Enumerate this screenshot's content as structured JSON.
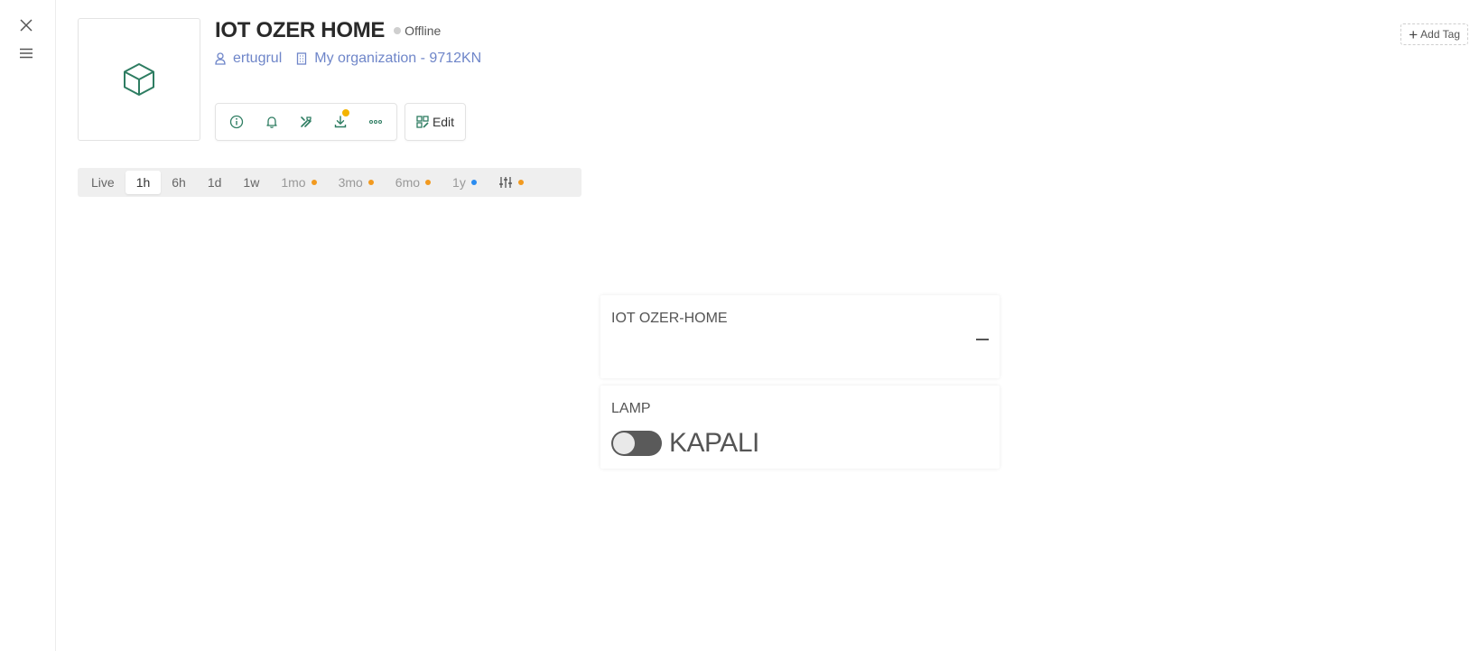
{
  "device": {
    "title": "IOT OZER HOME",
    "status": "Offline",
    "owner": "ertugrul",
    "organization": "My organization - 9712KN"
  },
  "toolbar": {
    "edit_label": "Edit",
    "icons": [
      "info-icon",
      "bell-icon",
      "tools-icon",
      "download-icon",
      "more-icon"
    ]
  },
  "add_tag_label": "Add Tag",
  "time_ranges": [
    {
      "label": "Live",
      "active": false,
      "dim": false,
      "dot": null
    },
    {
      "label": "1h",
      "active": true,
      "dim": false,
      "dot": null
    },
    {
      "label": "6h",
      "active": false,
      "dim": false,
      "dot": null
    },
    {
      "label": "1d",
      "active": false,
      "dim": false,
      "dot": null
    },
    {
      "label": "1w",
      "active": false,
      "dim": false,
      "dot": null
    },
    {
      "label": "1mo",
      "active": false,
      "dim": true,
      "dot": "#f29a1f"
    },
    {
      "label": "3mo",
      "active": false,
      "dim": true,
      "dot": "#f29a1f"
    },
    {
      "label": "6mo",
      "active": false,
      "dim": true,
      "dot": "#f29a1f"
    },
    {
      "label": "1y",
      "active": false,
      "dim": true,
      "dot": "#2b8cf0"
    }
  ],
  "custom_range_dot": "#f29a1f",
  "widgets": {
    "value_widget": {
      "title": "IOT OZER-HOME",
      "value": "–"
    },
    "switch_widget": {
      "title": "LAMP",
      "state_label": "KAPALI",
      "on": false
    }
  },
  "colors": {
    "accent_green": "#2e7d62",
    "link_blue": "#6f86c9",
    "notification_badge": "#f4b400"
  }
}
